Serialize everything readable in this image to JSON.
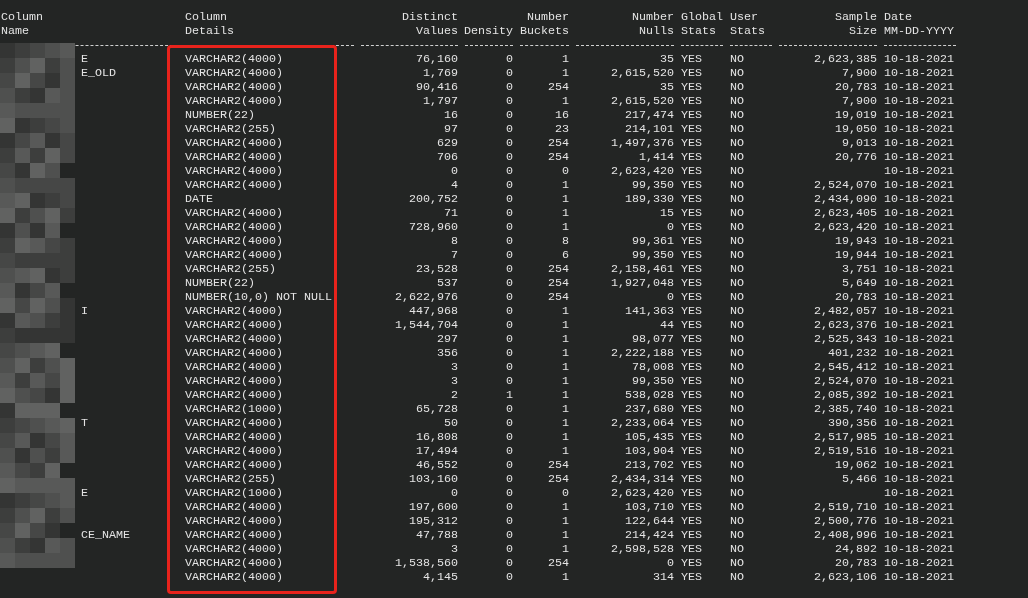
{
  "table": {
    "columns": [
      {
        "top": "Column",
        "bottom": "Name"
      },
      {
        "top": "Column",
        "bottom": "Details"
      },
      {
        "top": "Distinct",
        "bottom": "Values"
      },
      {
        "bottom": "Density"
      },
      {
        "top": "Number",
        "bottom": "Buckets"
      },
      {
        "top": "Number",
        "bottom": "Nulls"
      },
      {
        "top": "Global",
        "bottom": "Stats"
      },
      {
        "top": "User",
        "bottom": "Stats"
      },
      {
        "top": "Sample",
        "bottom": "Size"
      },
      {
        "top": "Date",
        "bottom": "MM-DD-YYYY"
      }
    ],
    "rows": [
      {
        "name": "E",
        "details": "VARCHAR2(4000)",
        "distinct_values": "76,160",
        "density": "0",
        "number_buckets": "1",
        "number_nulls": "35",
        "global_stats": "YES",
        "user_stats": "NO",
        "sample_size": "2,623,385",
        "date": "10-18-2021"
      },
      {
        "name": "E_OLD",
        "details": "VARCHAR2(4000)",
        "distinct_values": "1,769",
        "density": "0",
        "number_buckets": "1",
        "number_nulls": "2,615,520",
        "global_stats": "YES",
        "user_stats": "NO",
        "sample_size": "7,900",
        "date": "10-18-2021"
      },
      {
        "details": "VARCHAR2(4000)",
        "distinct_values": "90,416",
        "density": "0",
        "number_buckets": "254",
        "number_nulls": "35",
        "global_stats": "YES",
        "user_stats": "NO",
        "sample_size": "20,783",
        "date": "10-18-2021"
      },
      {
        "details": "VARCHAR2(4000)",
        "distinct_values": "1,797",
        "density": "0",
        "number_buckets": "1",
        "number_nulls": "2,615,520",
        "global_stats": "YES",
        "user_stats": "NO",
        "sample_size": "7,900",
        "date": "10-18-2021"
      },
      {
        "details": "NUMBER(22)",
        "distinct_values": "16",
        "density": "0",
        "number_buckets": "16",
        "number_nulls": "217,474",
        "global_stats": "YES",
        "user_stats": "NO",
        "sample_size": "19,019",
        "date": "10-18-2021"
      },
      {
        "details": "VARCHAR2(255)",
        "distinct_values": "97",
        "density": "0",
        "number_buckets": "23",
        "number_nulls": "214,101",
        "global_stats": "YES",
        "user_stats": "NO",
        "sample_size": "19,050",
        "date": "10-18-2021"
      },
      {
        "details": "VARCHAR2(4000)",
        "distinct_values": "629",
        "density": "0",
        "number_buckets": "254",
        "number_nulls": "1,497,376",
        "global_stats": "YES",
        "user_stats": "NO",
        "sample_size": "9,013",
        "date": "10-18-2021"
      },
      {
        "details": "VARCHAR2(4000)",
        "distinct_values": "706",
        "density": "0",
        "number_buckets": "254",
        "number_nulls": "1,414",
        "global_stats": "YES",
        "user_stats": "NO",
        "sample_size": "20,776",
        "date": "10-18-2021"
      },
      {
        "details": "VARCHAR2(4000)",
        "distinct_values": "0",
        "density": "0",
        "number_buckets": "0",
        "number_nulls": "2,623,420",
        "global_stats": "YES",
        "user_stats": "NO",
        "date": "10-18-2021"
      },
      {
        "details": "VARCHAR2(4000)",
        "distinct_values": "4",
        "density": "0",
        "number_buckets": "1",
        "number_nulls": "99,350",
        "global_stats": "YES",
        "user_stats": "NO",
        "sample_size": "2,524,070",
        "date": "10-18-2021"
      },
      {
        "details": "DATE",
        "distinct_values": "200,752",
        "density": "0",
        "number_buckets": "1",
        "number_nulls": "189,330",
        "global_stats": "YES",
        "user_stats": "NO",
        "sample_size": "2,434,090",
        "date": "10-18-2021"
      },
      {
        "details": "VARCHAR2(4000)",
        "distinct_values": "71",
        "density": "0",
        "number_buckets": "1",
        "number_nulls": "15",
        "global_stats": "YES",
        "user_stats": "NO",
        "sample_size": "2,623,405",
        "date": "10-18-2021"
      },
      {
        "details": "VARCHAR2(4000)",
        "distinct_values": "728,960",
        "density": "0",
        "number_buckets": "1",
        "number_nulls": "0",
        "global_stats": "YES",
        "user_stats": "NO",
        "sample_size": "2,623,420",
        "date": "10-18-2021"
      },
      {
        "details": "VARCHAR2(4000)",
        "distinct_values": "8",
        "density": "0",
        "number_buckets": "8",
        "number_nulls": "99,361",
        "global_stats": "YES",
        "user_stats": "NO",
        "sample_size": "19,943",
        "date": "10-18-2021"
      },
      {
        "details": "VARCHAR2(4000)",
        "distinct_values": "7",
        "density": "0",
        "number_buckets": "6",
        "number_nulls": "99,350",
        "global_stats": "YES",
        "user_stats": "NO",
        "sample_size": "19,944",
        "date": "10-18-2021"
      },
      {
        "details": "VARCHAR2(255)",
        "distinct_values": "23,528",
        "density": "0",
        "number_buckets": "254",
        "number_nulls": "2,158,461",
        "global_stats": "YES",
        "user_stats": "NO",
        "sample_size": "3,751",
        "date": "10-18-2021"
      },
      {
        "details": "NUMBER(22)",
        "distinct_values": "537",
        "density": "0",
        "number_buckets": "254",
        "number_nulls": "1,927,048",
        "global_stats": "YES",
        "user_stats": "NO",
        "sample_size": "5,649",
        "date": "10-18-2021"
      },
      {
        "details": "NUMBER(10,0) NOT NULL",
        "distinct_values": "2,622,976",
        "density": "0",
        "number_buckets": "254",
        "number_nulls": "0",
        "global_stats": "YES",
        "user_stats": "NO",
        "sample_size": "20,783",
        "date": "10-18-2021"
      },
      {
        "name": "I",
        "details": "VARCHAR2(4000)",
        "distinct_values": "447,968",
        "density": "0",
        "number_buckets": "1",
        "number_nulls": "141,363",
        "global_stats": "YES",
        "user_stats": "NO",
        "sample_size": "2,482,057",
        "date": "10-18-2021"
      },
      {
        "details": "VARCHAR2(4000)",
        "distinct_values": "1,544,704",
        "density": "0",
        "number_buckets": "1",
        "number_nulls": "44",
        "global_stats": "YES",
        "user_stats": "NO",
        "sample_size": "2,623,376",
        "date": "10-18-2021"
      },
      {
        "details": "VARCHAR2(4000)",
        "distinct_values": "297",
        "density": "0",
        "number_buckets": "1",
        "number_nulls": "98,077",
        "global_stats": "YES",
        "user_stats": "NO",
        "sample_size": "2,525,343",
        "date": "10-18-2021"
      },
      {
        "details": "VARCHAR2(4000)",
        "distinct_values": "356",
        "density": "0",
        "number_buckets": "1",
        "number_nulls": "2,222,188",
        "global_stats": "YES",
        "user_stats": "NO",
        "sample_size": "401,232",
        "date": "10-18-2021"
      },
      {
        "details": "VARCHAR2(4000)",
        "distinct_values": "3",
        "density": "0",
        "number_buckets": "1",
        "number_nulls": "78,008",
        "global_stats": "YES",
        "user_stats": "NO",
        "sample_size": "2,545,412",
        "date": "10-18-2021"
      },
      {
        "details": "VARCHAR2(4000)",
        "distinct_values": "3",
        "density": "0",
        "number_buckets": "1",
        "number_nulls": "99,350",
        "global_stats": "YES",
        "user_stats": "NO",
        "sample_size": "2,524,070",
        "date": "10-18-2021"
      },
      {
        "details": "VARCHAR2(4000)",
        "distinct_values": "2",
        "density": "1",
        "number_buckets": "1",
        "number_nulls": "538,028",
        "global_stats": "YES",
        "user_stats": "NO",
        "sample_size": "2,085,392",
        "date": "10-18-2021"
      },
      {
        "details": "VARCHAR2(1000)",
        "distinct_values": "65,728",
        "density": "0",
        "number_buckets": "1",
        "number_nulls": "237,680",
        "global_stats": "YES",
        "user_stats": "NO",
        "sample_size": "2,385,740",
        "date": "10-18-2021"
      },
      {
        "name": "T",
        "details": "VARCHAR2(4000)",
        "distinct_values": "50",
        "density": "0",
        "number_buckets": "1",
        "number_nulls": "2,233,064",
        "global_stats": "YES",
        "user_stats": "NO",
        "sample_size": "390,356",
        "date": "10-18-2021"
      },
      {
        "details": "VARCHAR2(4000)",
        "distinct_values": "16,808",
        "density": "0",
        "number_buckets": "1",
        "number_nulls": "105,435",
        "global_stats": "YES",
        "user_stats": "NO",
        "sample_size": "2,517,985",
        "date": "10-18-2021"
      },
      {
        "details": "VARCHAR2(4000)",
        "distinct_values": "17,494",
        "density": "0",
        "number_buckets": "1",
        "number_nulls": "103,904",
        "global_stats": "YES",
        "user_stats": "NO",
        "sample_size": "2,519,516",
        "date": "10-18-2021"
      },
      {
        "details": "VARCHAR2(4000)",
        "distinct_values": "46,552",
        "density": "0",
        "number_buckets": "254",
        "number_nulls": "213,702",
        "global_stats": "YES",
        "user_stats": "NO",
        "sample_size": "19,062",
        "date": "10-18-2021"
      },
      {
        "details": "VARCHAR2(255)",
        "distinct_values": "103,160",
        "density": "0",
        "number_buckets": "254",
        "number_nulls": "2,434,314",
        "global_stats": "YES",
        "user_stats": "NO",
        "sample_size": "5,466",
        "date": "10-18-2021"
      },
      {
        "name": "E",
        "details": "VARCHAR2(1000)",
        "distinct_values": "0",
        "density": "0",
        "number_buckets": "0",
        "number_nulls": "2,623,420",
        "global_stats": "YES",
        "user_stats": "NO",
        "date": "10-18-2021"
      },
      {
        "details": "VARCHAR2(4000)",
        "distinct_values": "197,600",
        "density": "0",
        "number_buckets": "1",
        "number_nulls": "103,710",
        "global_stats": "YES",
        "user_stats": "NO",
        "sample_size": "2,519,710",
        "date": "10-18-2021"
      },
      {
        "details": "VARCHAR2(4000)",
        "distinct_values": "195,312",
        "density": "0",
        "number_buckets": "1",
        "number_nulls": "122,644",
        "global_stats": "YES",
        "user_stats": "NO",
        "sample_size": "2,500,776",
        "date": "10-18-2021"
      },
      {
        "name": "CE_NAME",
        "details": "VARCHAR2(4000)",
        "distinct_values": "47,788",
        "density": "0",
        "number_buckets": "1",
        "number_nulls": "214,424",
        "global_stats": "YES",
        "user_stats": "NO",
        "sample_size": "2,408,996",
        "date": "10-18-2021"
      },
      {
        "details": "VARCHAR2(4000)",
        "distinct_values": "3",
        "density": "0",
        "number_buckets": "1",
        "number_nulls": "2,598,528",
        "global_stats": "YES",
        "user_stats": "NO",
        "sample_size": "24,892",
        "date": "10-18-2021"
      },
      {
        "details": "VARCHAR2(4000)",
        "distinct_values": "1,538,560",
        "density": "0",
        "number_buckets": "254",
        "number_nulls": "0",
        "global_stats": "YES",
        "user_stats": "NO",
        "sample_size": "20,783",
        "date": "10-18-2021"
      },
      {
        "details": "VARCHAR2(4000)",
        "distinct_values": "4,145",
        "density": "0",
        "number_buckets": "1",
        "number_nulls": "314",
        "global_stats": "YES",
        "user_stats": "NO",
        "sample_size": "2,623,106",
        "date": "10-18-2021"
      }
    ]
  }
}
